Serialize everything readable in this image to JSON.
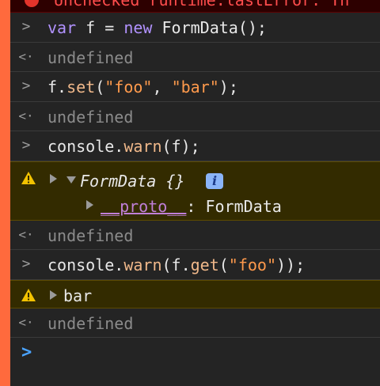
{
  "error_banner": {
    "text": "Unchecked runtime.lastError: Th"
  },
  "glyphs": {
    "prompt": ">",
    "result": "<·",
    "caret": ">"
  },
  "entries": [
    {
      "input": {
        "kw": "var",
        "rest": " f = ",
        "kw2": "new",
        "rest2": " FormData();"
      },
      "result": "undefined"
    },
    {
      "input": {
        "obj": "f.",
        "method": "set",
        "open": "(",
        "str1": "\"foo\"",
        "sep": ", ",
        "str2": "\"bar\"",
        "close": ");"
      },
      "result": "undefined"
    },
    {
      "input": {
        "obj": "console.",
        "method": "warn",
        "rest": "(f);"
      }
    },
    {
      "input": {
        "obj": "console.",
        "method": "warn",
        "mid": "(f.",
        "method2": "get",
        "open": "(",
        "str": "\"foo\"",
        "close": "));"
      },
      "result": "undefined"
    }
  ],
  "warning_formdata": {
    "label": "FormData {}",
    "info_badge": "i",
    "proto_key": "__proto__",
    "proto_sep": ": ",
    "proto_value": "FormData"
  },
  "warning_bar": {
    "value": "bar"
  },
  "result_after_first_warning": "undefined",
  "colors": {
    "accent_bar": "#ff6a3d",
    "keyword": "#b192ff",
    "string": "#ff9a4c",
    "warning_bg": "#332b00",
    "prompt_caret": "#4aa3ff"
  }
}
